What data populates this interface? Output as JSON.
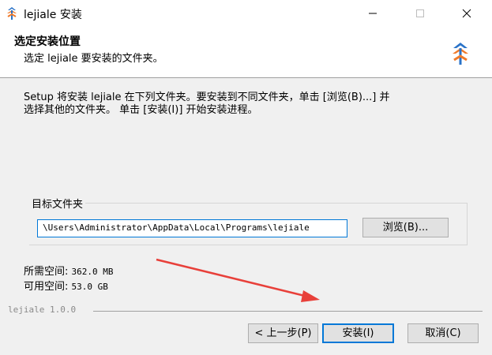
{
  "window": {
    "title": "lejiale 安装",
    "icon": "lejiale-logo-icon"
  },
  "header": {
    "title": "选定安装位置",
    "subtitle": "选定 lejiale 要安装的文件夹。"
  },
  "intro": {
    "line1": "Setup 将安装 lejiale 在下列文件夹。要安装到不同文件夹，单击 [浏览(B)...] 并",
    "line2": "选择其他的文件夹。 单击 [安装(I)] 开始安装进程。"
  },
  "destination": {
    "group_label": "目标文件夹",
    "path": "\\Users\\Administrator\\AppData\\Local\\Programs\\lejiale",
    "browse_label": "浏览(B)..."
  },
  "space": {
    "required_label": "所需空间:",
    "required_value": "362.0 MB",
    "available_label": "可用空间:",
    "available_value": "53.0 GB"
  },
  "footer": {
    "brand": "lejiale 1.0.0",
    "back_label": "< 上一步(P)",
    "install_label": "安装(I)",
    "cancel_label": "取消(C)"
  },
  "colors": {
    "accent": "#0078d7",
    "arrow": "#e8403a",
    "logo_blue": "#2a73c8",
    "logo_orange": "#f07a2a"
  }
}
